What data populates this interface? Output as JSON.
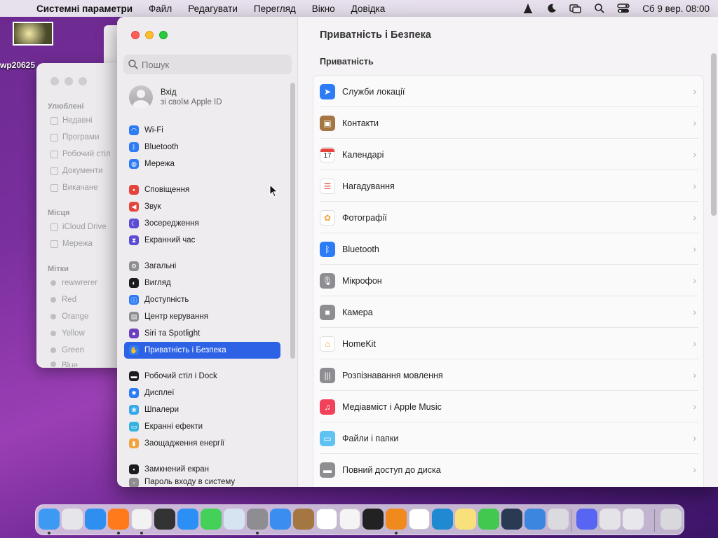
{
  "menubar": {
    "app_name": "Системні параметри",
    "items": [
      "Файл",
      "Редагувати",
      "Перегляд",
      "Вікно",
      "Довідка"
    ],
    "clock": "Сб 9 вер.  08:00",
    "icons": [
      "vlc-icon",
      "dark-mode-icon",
      "screen-mirroring-icon",
      "search-icon",
      "control-center-icon"
    ]
  },
  "desktop": {
    "file_label": "wp20625"
  },
  "finder": {
    "sections": [
      {
        "title": "Улюблені",
        "items": [
          "Недавні",
          "Програми",
          "Робочий стіл",
          "Документи",
          "Викачане"
        ]
      },
      {
        "title": "Місця",
        "items": [
          "iCloud Drive",
          "Мережа"
        ]
      },
      {
        "title": "Мітки",
        "items": [
          "rewwrerer",
          "Red",
          "Orange",
          "Yellow",
          "Green",
          "Blue"
        ]
      }
    ]
  },
  "settings": {
    "search_placeholder": "Пошук",
    "account": {
      "line1": "Вхід",
      "line2": "зі своїм Apple ID"
    },
    "sidebar": [
      {
        "label": "Wi-Fi",
        "icon": "wifi-icon",
        "color": "#2d7cf6"
      },
      {
        "label": "Bluetooth",
        "icon": "bluetooth-icon",
        "color": "#2d7cf6"
      },
      {
        "label": "Мережа",
        "icon": "network-icon",
        "color": "#2d7cf6"
      },
      {
        "label": "Сповіщення",
        "icon": "notifications-icon",
        "color": "#e5443c"
      },
      {
        "label": "Звук",
        "icon": "sound-icon",
        "color": "#e5443c"
      },
      {
        "label": "Зосередження",
        "icon": "focus-icon",
        "color": "#5b4cd6"
      },
      {
        "label": "Екранний час",
        "icon": "screen-time-icon",
        "color": "#5b4cd6"
      },
      {
        "label": "Загальні",
        "icon": "general-icon",
        "color": "#8e8d92"
      },
      {
        "label": "Вигляд",
        "icon": "appearance-icon",
        "color": "#1c1c1e"
      },
      {
        "label": "Доступність",
        "icon": "accessibility-icon",
        "color": "#2d7cf6"
      },
      {
        "label": "Центр керування",
        "icon": "control-center-icon",
        "color": "#8e8d92"
      },
      {
        "label": "Siri та Spotlight",
        "icon": "siri-icon",
        "color": "#6b3fbf"
      },
      {
        "label": "Приватність і Безпека",
        "icon": "privacy-hand-icon",
        "color": "#2d7cf6"
      },
      {
        "label": "Робочий стіл і Dock",
        "icon": "desktop-dock-icon",
        "color": "#1c1c1e"
      },
      {
        "label": "Дисплеї",
        "icon": "displays-icon",
        "color": "#2d7cf6"
      },
      {
        "label": "Шпалери",
        "icon": "wallpaper-icon",
        "color": "#36a9e8"
      },
      {
        "label": "Екранні ефекти",
        "icon": "screensaver-icon",
        "color": "#36b4e0"
      },
      {
        "label": "Заощадження енергії",
        "icon": "energy-icon",
        "color": "#f2a23a"
      },
      {
        "label": "Замкнений екран",
        "icon": "lock-screen-icon",
        "color": "#1c1c1e"
      },
      {
        "label": "Пароль входу в систему",
        "icon": "login-password-icon",
        "color": "#8e8d92"
      }
    ],
    "selected": "Приватність і Безпека",
    "pane": {
      "title": "Приватність і Безпека",
      "section": "Приватність",
      "rows": [
        {
          "label": "Служби локації",
          "icon": "location-icon",
          "color": "#2d7cf6"
        },
        {
          "label": "Контакти",
          "icon": "contacts-icon",
          "color": "#a47642"
        },
        {
          "label": "Календарі",
          "icon": "calendar-icon",
          "color": "#ffffff"
        },
        {
          "label": "Нагадування",
          "icon": "reminders-icon",
          "color": "#ffffff"
        },
        {
          "label": "Фотографії",
          "icon": "photos-icon",
          "color": "#ffffff"
        },
        {
          "label": "Bluetooth",
          "icon": "bluetooth-icon",
          "color": "#2d7cf6"
        },
        {
          "label": "Мікрофон",
          "icon": "microphone-icon",
          "color": "#8e8d92"
        },
        {
          "label": "Камера",
          "icon": "camera-icon",
          "color": "#8e8d92"
        },
        {
          "label": "HomeKit",
          "icon": "homekit-icon",
          "color": "#ffffff"
        },
        {
          "label": "Розпізнавання мовлення",
          "icon": "speech-recognition-icon",
          "color": "#8e8d92"
        },
        {
          "label": "Медіавміст і Apple Music",
          "icon": "music-icon",
          "color": "#f2425a"
        },
        {
          "label": "Файли і папки",
          "icon": "folder-icon",
          "color": "#5ec2f2"
        },
        {
          "label": "Повний доступ до диска",
          "icon": "disk-icon",
          "color": "#8e8d92"
        }
      ]
    }
  },
  "calendar_date": "17",
  "dock": {
    "apps": [
      {
        "name": "finder-icon",
        "color": "#3d9af2",
        "running": true
      },
      {
        "name": "launchpad-icon",
        "color": "#e6e6ea",
        "running": false
      },
      {
        "name": "safari-icon",
        "color": "#2f8ff0",
        "running": false
      },
      {
        "name": "firefox-icon",
        "color": "#ff7a1a",
        "running": true
      },
      {
        "name": "chrome-icon",
        "color": "#f2f2f2",
        "running": true
      },
      {
        "name": "guitar-app-icon",
        "color": "#333333",
        "running": false
      },
      {
        "name": "app-store-icon",
        "color": "#2b8ff5",
        "running": false
      },
      {
        "name": "messages-icon",
        "color": "#43d15a",
        "running": false
      },
      {
        "name": "preview-icon",
        "color": "#d6e4f2",
        "running": false
      },
      {
        "name": "system-settings-icon",
        "color": "#8e8d92",
        "running": true
      },
      {
        "name": "mail-icon",
        "color": "#3a8ef0",
        "running": false
      },
      {
        "name": "contacts-icon",
        "color": "#a47642",
        "running": false
      },
      {
        "name": "calendar-icon",
        "color": "#ffffff",
        "running": false
      },
      {
        "name": "textedit-icon",
        "color": "#f4f4f4",
        "running": false
      },
      {
        "name": "terminal-icon",
        "color": "#222222",
        "running": false
      },
      {
        "name": "vlc-icon",
        "color": "#f08a1c",
        "running": true
      },
      {
        "name": "reminders-icon",
        "color": "#ffffff",
        "running": false
      },
      {
        "name": "vscode-icon",
        "color": "#1f8ad2",
        "running": false
      },
      {
        "name": "notes-icon",
        "color": "#f8e07a",
        "running": false
      },
      {
        "name": "facetime-icon",
        "color": "#43c84f",
        "running": false
      },
      {
        "name": "quicktime-icon",
        "color": "#2a3a52",
        "running": false
      },
      {
        "name": "xcode-icon",
        "color": "#3d86e0",
        "running": false
      },
      {
        "name": "migration-icon",
        "color": "#dadadf",
        "running": false
      },
      {
        "name": "discord-icon",
        "color": "#5865f2",
        "running": false
      },
      {
        "name": "screenshot-icon",
        "color": "#e4e4e8",
        "running": false
      },
      {
        "name": "printer-icon",
        "color": "#e8e8ec",
        "running": false
      },
      {
        "name": "trash-icon",
        "color": "#d9d9dd",
        "running": false
      }
    ]
  }
}
